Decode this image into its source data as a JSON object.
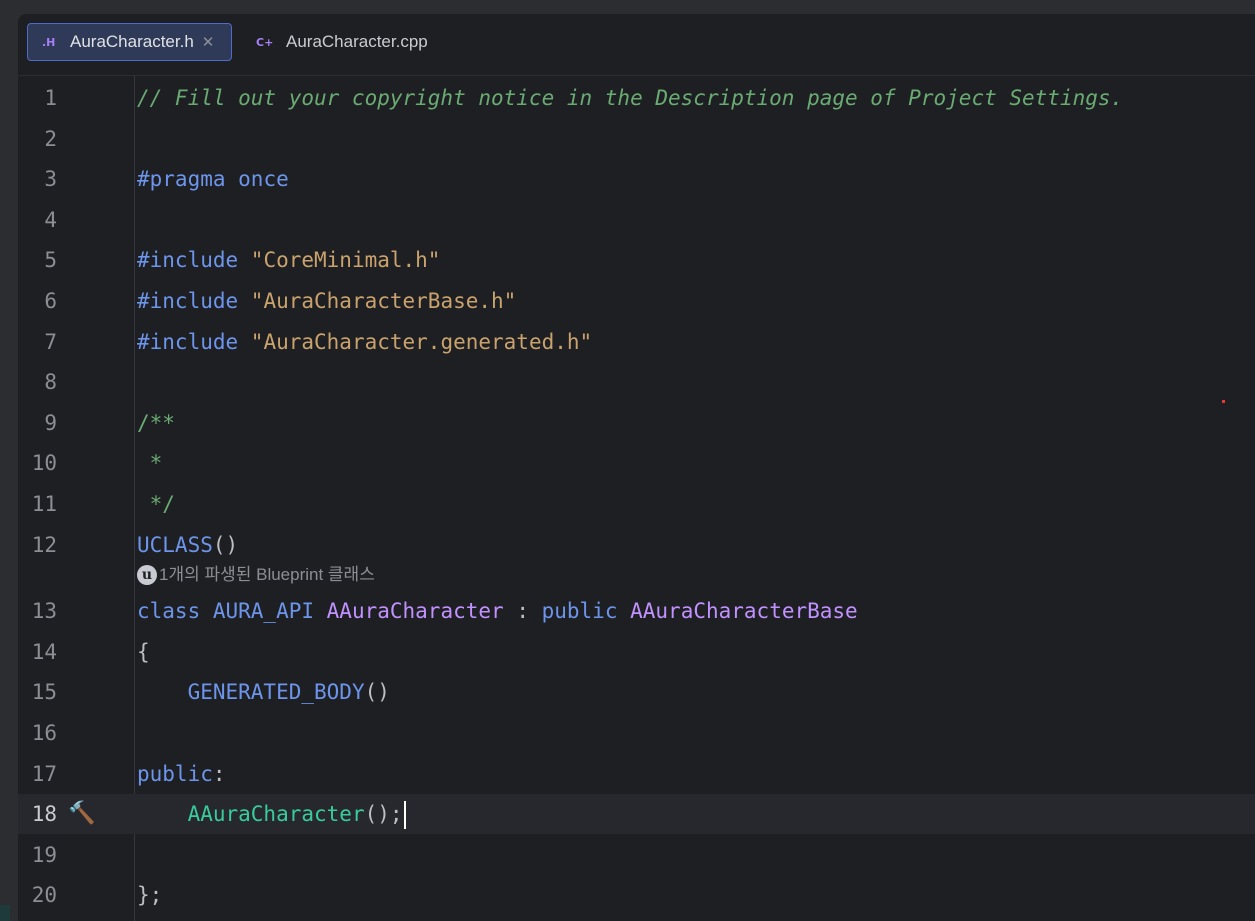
{
  "tabs": [
    {
      "icon": "header-file-icon",
      "glyph": ".H",
      "label": "AuraCharacter.h",
      "active": true,
      "close": "✕"
    },
    {
      "icon": "cpp-file-icon",
      "glyph": "C+",
      "label": "AuraCharacter.cpp",
      "active": false
    }
  ],
  "editor": {
    "current_line": 18,
    "lines": [
      {
        "n": "1",
        "tokens": [
          {
            "t": "// Fill out your copyright notice in the Description page of Project Settings.",
            "c": "comment"
          }
        ]
      },
      {
        "n": "2",
        "tokens": []
      },
      {
        "n": "3",
        "tokens": [
          {
            "t": "#pragma ",
            "c": "kw"
          },
          {
            "t": "once",
            "c": "kw"
          }
        ]
      },
      {
        "n": "4",
        "tokens": []
      },
      {
        "n": "5",
        "tokens": [
          {
            "t": "#include ",
            "c": "kw"
          },
          {
            "t": "\"CoreMinimal.h\"",
            "c": "str"
          }
        ]
      },
      {
        "n": "6",
        "tokens": [
          {
            "t": "#include ",
            "c": "kw"
          },
          {
            "t": "\"AuraCharacterBase.h\"",
            "c": "str"
          }
        ]
      },
      {
        "n": "7",
        "tokens": [
          {
            "t": "#include ",
            "c": "kw"
          },
          {
            "t": "\"AuraCharacter.generated.h\"",
            "c": "str"
          }
        ]
      },
      {
        "n": "8",
        "tokens": []
      },
      {
        "n": "9",
        "tokens": [
          {
            "t": "/**",
            "c": "doc"
          }
        ]
      },
      {
        "n": "10",
        "tokens": [
          {
            "t": " *",
            "c": "doc"
          }
        ]
      },
      {
        "n": "11",
        "tokens": [
          {
            "t": " */",
            "c": "doc"
          }
        ]
      },
      {
        "n": "12",
        "tokens": [
          {
            "t": "UCLASS",
            "c": "macro"
          },
          {
            "t": "()",
            "c": "punc"
          }
        ]
      },
      {
        "n": "13",
        "tokens": [
          {
            "t": "class ",
            "c": "kw"
          },
          {
            "t": "AURA_API ",
            "c": "macro"
          },
          {
            "t": "AAuraCharacter",
            "c": "class"
          },
          {
            "t": " : ",
            "c": "punc"
          },
          {
            "t": "public ",
            "c": "kw"
          },
          {
            "t": "AAuraCharacterBase",
            "c": "class"
          }
        ]
      },
      {
        "n": "14",
        "tokens": [
          {
            "t": "{",
            "c": "punc"
          }
        ]
      },
      {
        "n": "15",
        "tokens": [
          {
            "t": "    ",
            "c": "punc"
          },
          {
            "t": "GENERATED_BODY",
            "c": "macro"
          },
          {
            "t": "()",
            "c": "punc"
          }
        ]
      },
      {
        "n": "16",
        "tokens": []
      },
      {
        "n": "17",
        "tokens": [
          {
            "t": "public",
            "c": "kw"
          },
          {
            "t": ":",
            "c": "punc"
          }
        ]
      },
      {
        "n": "18",
        "tokens": [
          {
            "t": "    ",
            "c": "punc"
          },
          {
            "t": "AAuraCharacter",
            "c": "func"
          },
          {
            "t": "();",
            "c": "punc"
          }
        ]
      },
      {
        "n": "19",
        "tokens": []
      },
      {
        "n": "20",
        "tokens": [
          {
            "t": "};",
            "c": "punc"
          }
        ]
      }
    ],
    "inlay_hint": {
      "after_line": 12,
      "icon": "unreal-engine-icon",
      "text": "1개의 파생된 Blueprint 클래스"
    },
    "gutter_icon": {
      "line": 18,
      "icon": "hammer-icon",
      "glyph": "🔨"
    }
  },
  "colors": {
    "background": "#1e1f22",
    "comment": "#6aab73",
    "keyword": "#6c95eb",
    "string": "#c9a26d",
    "class": "#c191ff",
    "function": "#39cc9b",
    "active_tab_border": "#4f6ac7"
  }
}
